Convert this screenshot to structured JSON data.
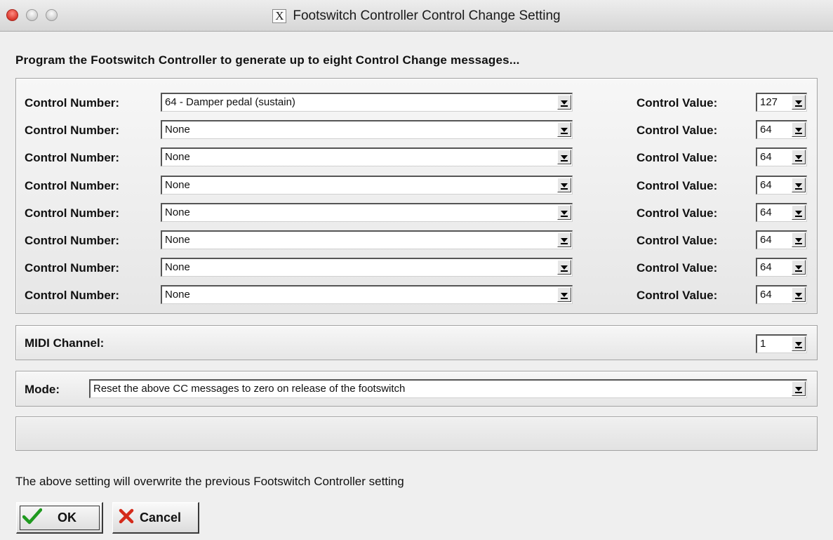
{
  "window": {
    "title": "Footswitch Controller Control Change Setting",
    "app_icon": "x11-icon"
  },
  "heading": "Program the Footswitch Controller to generate up to eight Control Change messages...",
  "cc_rows": [
    {
      "number_label": "Control Number:",
      "number_value": "64 - Damper pedal (sustain)",
      "value_label": "Control Value:",
      "value": "127"
    },
    {
      "number_label": "Control Number:",
      "number_value": "None",
      "value_label": "Control Value:",
      "value": "64"
    },
    {
      "number_label": "Control Number:",
      "number_value": "None",
      "value_label": "Control Value:",
      "value": "64"
    },
    {
      "number_label": "Control Number:",
      "number_value": "None",
      "value_label": "Control Value:",
      "value": "64"
    },
    {
      "number_label": "Control Number:",
      "number_value": "None",
      "value_label": "Control Value:",
      "value": "64"
    },
    {
      "number_label": "Control Number:",
      "number_value": "None",
      "value_label": "Control Value:",
      "value": "64"
    },
    {
      "number_label": "Control Number:",
      "number_value": "None",
      "value_label": "Control Value:",
      "value": "64"
    },
    {
      "number_label": "Control Number:",
      "number_value": "None",
      "value_label": "Control Value:",
      "value": "64"
    }
  ],
  "midi": {
    "label": "MIDI Channel:",
    "value": "1"
  },
  "mode": {
    "label": "Mode:",
    "value": "Reset the above CC messages to zero on release of the footswitch"
  },
  "status": {
    "text": ""
  },
  "footer": "The above setting will overwrite the previous Footswitch Controller setting",
  "buttons": {
    "ok": "OK",
    "cancel": "Cancel",
    "ok_icon": "checkmark-icon",
    "cancel_icon": "x-icon"
  },
  "colors": {
    "ok_check": "#1f9a1f",
    "cancel_x": "#d42a1a",
    "close_light": "#d9362b"
  }
}
